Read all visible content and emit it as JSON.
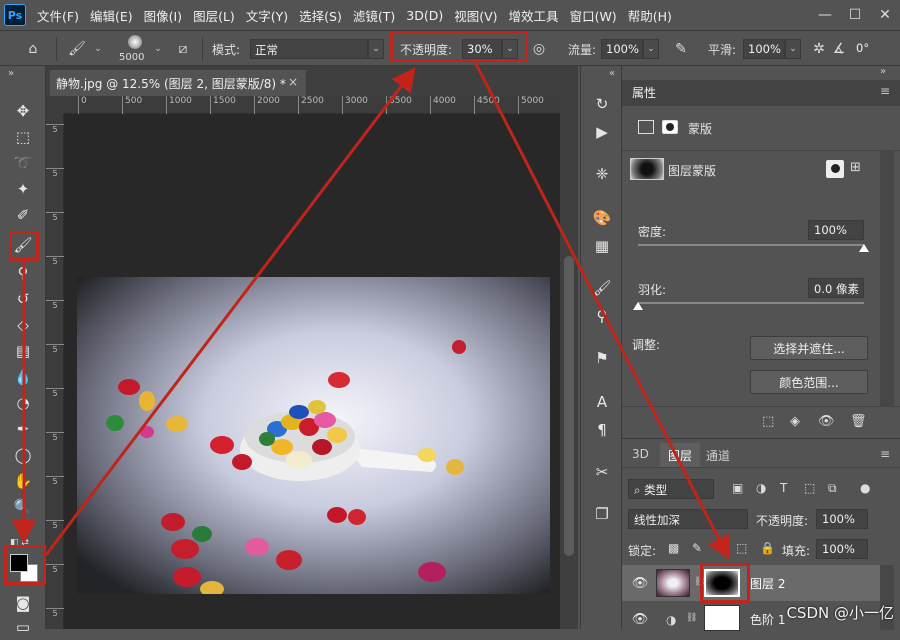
{
  "menubar": {
    "logo": "Ps",
    "items": [
      "文件(F)",
      "编辑(E)",
      "图像(I)",
      "图层(L)",
      "文字(Y)",
      "选择(S)",
      "滤镜(T)",
      "3D(D)",
      "视图(V)",
      "增效工具",
      "窗口(W)",
      "帮助(H)"
    ]
  },
  "options": {
    "brush_size": "5000",
    "mode_label": "模式:",
    "mode_value": "正常",
    "opacity_label": "不透明度:",
    "opacity_value": "30%",
    "flow_label": "流量:",
    "flow_value": "100%",
    "smooth_label": "平滑:",
    "smooth_value": "100%",
    "angle_value": "0°"
  },
  "document": {
    "tab_title": "静物.jpg @ 12.5% (图层 2, 图层蒙版/8) *",
    "ruler_marks": [
      "0",
      "500",
      "1000",
      "1500",
      "2000",
      "2500",
      "3000",
      "3500",
      "4000",
      "4500",
      "5000"
    ]
  },
  "properties": {
    "title": "属性",
    "mask_section": "蒙版",
    "layer_mask_label": "图层蒙版",
    "density_label": "密度:",
    "density_value": "100%",
    "density_level": 1.0,
    "feather_label": "羽化:",
    "feather_value": "0.0 像素",
    "feather_level": 0.0,
    "adjust_label": "调整:",
    "select_mask_button": "选择并遮住...",
    "color_range_button": "颜色范围..."
  },
  "layers": {
    "tabs": [
      "3D",
      "图层",
      "通道"
    ],
    "active_tab": "图层",
    "filter_kind": "类型",
    "blend_mode": "线性加深",
    "opacity_label": "不透明度:",
    "opacity_value": "100%",
    "lock_label": "锁定:",
    "fill_label": "填充:",
    "fill_value": "100%",
    "rows": [
      {
        "name": "图层 2"
      },
      {
        "name": "色阶 1"
      }
    ]
  },
  "watermark": "CSDN @小一亿",
  "colors": {
    "annotation_red": "#c0241b",
    "foreground": "#000000",
    "background": "#ffffff"
  }
}
